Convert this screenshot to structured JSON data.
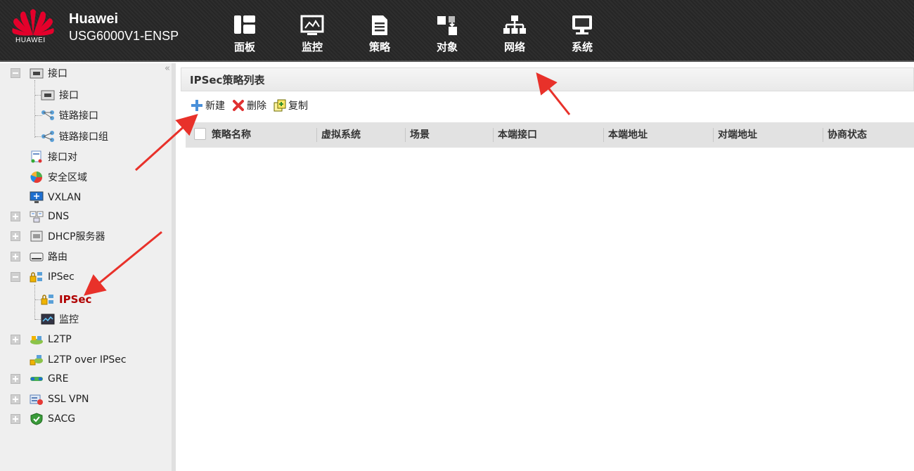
{
  "header": {
    "logo_text": "HUAWEI",
    "brand_name": "Huawei",
    "model": "USG6000V1-ENSP",
    "nav": [
      {
        "label": "面板",
        "icon": "dashboard-icon"
      },
      {
        "label": "监控",
        "icon": "monitor-icon"
      },
      {
        "label": "策略",
        "icon": "policy-icon"
      },
      {
        "label": "对象",
        "icon": "object-icon"
      },
      {
        "label": "网络",
        "icon": "network-icon",
        "active": true
      },
      {
        "label": "系统",
        "icon": "system-icon"
      }
    ]
  },
  "sidebar": {
    "collapse_glyph": "«",
    "items": [
      {
        "label": "接口",
        "icon": "interface-icon",
        "toggle": "minus"
      },
      {
        "label": "接口",
        "icon": "interface-icon",
        "child": true
      },
      {
        "label": "链路接口",
        "icon": "link-interface-icon",
        "child": true
      },
      {
        "label": "链路接口组",
        "icon": "link-group-icon",
        "child": true
      },
      {
        "label": "接口对",
        "icon": "interface-pair-icon"
      },
      {
        "label": "安全区域",
        "icon": "security-zone-icon"
      },
      {
        "label": "VXLAN",
        "icon": "vxlan-icon"
      },
      {
        "label": "DNS",
        "icon": "dns-icon",
        "toggle": "plus"
      },
      {
        "label": "DHCP服务器",
        "icon": "dhcp-server-icon",
        "toggle": "plus"
      },
      {
        "label": "路由",
        "icon": "route-icon",
        "toggle": "plus"
      },
      {
        "label": "IPSec",
        "icon": "ipsec-icon",
        "toggle": "minus"
      },
      {
        "label": "IPSec",
        "icon": "ipsec-icon",
        "child": true,
        "active": true
      },
      {
        "label": "监控",
        "icon": "monitor-icon",
        "child": true
      },
      {
        "label": "L2TP",
        "icon": "l2tp-icon",
        "toggle": "plus"
      },
      {
        "label": "L2TP over IPSec",
        "icon": "l2tp-ipsec-icon"
      },
      {
        "label": "GRE",
        "icon": "gre-icon",
        "toggle": "plus"
      },
      {
        "label": "SSL VPN",
        "icon": "ssl-vpn-icon",
        "toggle": "plus"
      },
      {
        "label": "SACG",
        "icon": "sacg-icon",
        "toggle": "plus"
      }
    ]
  },
  "main": {
    "title": "IPSec策略列表",
    "toolbar": {
      "new_label": "新建",
      "delete_label": "删除",
      "copy_label": "复制"
    },
    "columns": [
      "策略名称",
      "虚拟系统",
      "场景",
      "本端接口",
      "本端地址",
      "对端地址",
      "协商状态"
    ],
    "rows": []
  },
  "colors": {
    "header_bg": "#2b2b2b",
    "active_label": "#b00000",
    "annotation_arrow": "#e8312a",
    "sidebar_bg": "#efefef"
  }
}
